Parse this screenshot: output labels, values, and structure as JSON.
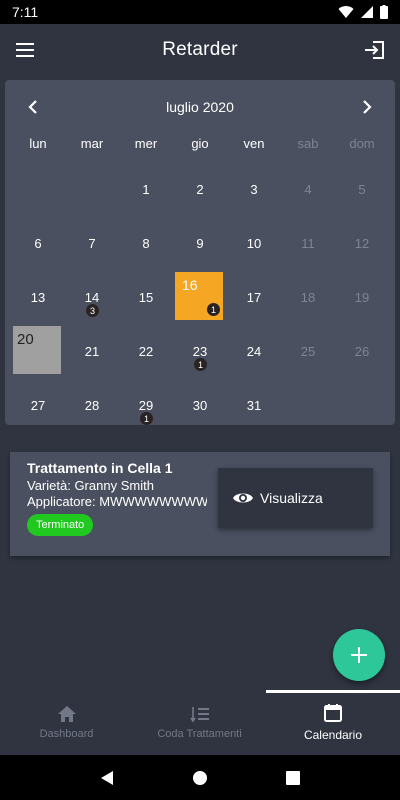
{
  "status_bar": {
    "time": "7:11"
  },
  "app_bar": {
    "title": "Retarder"
  },
  "calendar": {
    "month_label": "luglio 2020",
    "weekdays": [
      "lun",
      "mar",
      "mer",
      "gio",
      "ven",
      "sab",
      "dom"
    ],
    "days": [
      "1",
      "2",
      "3",
      "4",
      "5",
      "6",
      "7",
      "8",
      "9",
      "10",
      "11",
      "12",
      "13",
      "14",
      "15",
      "16",
      "17",
      "18",
      "19",
      "20",
      "21",
      "22",
      "23",
      "24",
      "25",
      "26",
      "27",
      "28",
      "29",
      "30",
      "31"
    ],
    "badges": {
      "d14": "3",
      "d16": "1",
      "d23": "1",
      "d29": "1"
    },
    "selected_day": "16",
    "today": "20",
    "colors": {
      "selected": "#f5a623",
      "today": "#a0a0a0"
    }
  },
  "card": {
    "title": "Trattamento in Cella 1",
    "variety_line": "Varietà: Granny Smith",
    "applicator_line": "Applicatore: MWWWWWWWWWWWWWW",
    "status": "Terminato",
    "status_color": "#20c820",
    "view_label": "Visualizza"
  },
  "fab": {
    "icon": "plus-icon",
    "color": "#2ec79a"
  },
  "bottom_nav": {
    "items": [
      {
        "label": "Dashboard",
        "icon": "home-icon"
      },
      {
        "label": "Coda Trattamenti",
        "icon": "queue-icon"
      },
      {
        "label": "Calendario",
        "icon": "calendar-icon"
      }
    ],
    "active": "Calendario"
  }
}
